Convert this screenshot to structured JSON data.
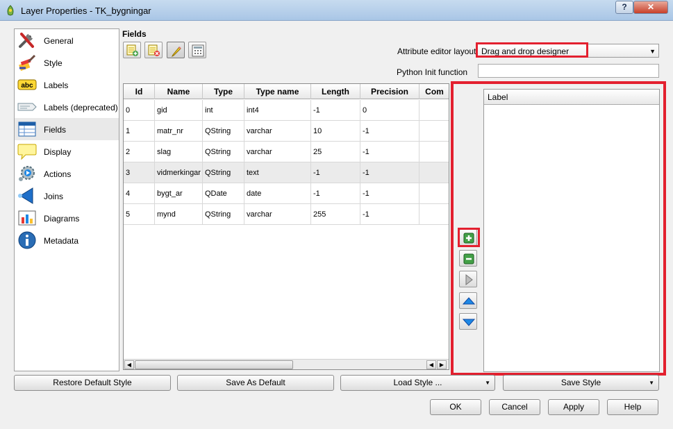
{
  "window": {
    "title": "Layer Properties - TK_bygningar",
    "help_label": "?",
    "close_label": "✕"
  },
  "sidebar": {
    "items": [
      {
        "label": "General",
        "icon": "tools-icon"
      },
      {
        "label": "Style",
        "icon": "brush-icon"
      },
      {
        "label": "Labels",
        "icon": "abc-label-icon"
      },
      {
        "label": "Labels (deprecated)",
        "icon": "label-tag-icon"
      },
      {
        "label": "Fields",
        "icon": "table-icon"
      },
      {
        "label": "Display",
        "icon": "speech-bubble-icon"
      },
      {
        "label": "Actions",
        "icon": "gear-play-icon"
      },
      {
        "label": "Joins",
        "icon": "join-arrow-icon"
      },
      {
        "label": "Diagrams",
        "icon": "chart-icon"
      },
      {
        "label": "Metadata",
        "icon": "info-icon"
      }
    ],
    "selected": "Fields"
  },
  "fields": {
    "title": "Fields",
    "columns": [
      "Id",
      "Name",
      "Type",
      "Type name",
      "Length",
      "Precision",
      "Com"
    ],
    "rows": [
      [
        "0",
        "gid",
        "int",
        "int4",
        "-1",
        "0",
        ""
      ],
      [
        "1",
        "matr_nr",
        "QString",
        "varchar",
        "10",
        "-1",
        ""
      ],
      [
        "2",
        "slag",
        "QString",
        "varchar",
        "25",
        "-1",
        ""
      ],
      [
        "3",
        "vidmerkingar",
        "QString",
        "text",
        "-1",
        "-1",
        ""
      ],
      [
        "4",
        "bygt_ar",
        "QDate",
        "date",
        "-1",
        "-1",
        ""
      ],
      [
        "5",
        "mynd",
        "QString",
        "varchar",
        "255",
        "-1",
        ""
      ]
    ],
    "highlighted_row": 3
  },
  "attribute_editor": {
    "layout_label": "Attribute editor layout:",
    "layout_value": "Drag and drop designer",
    "python_label": "Python Init function",
    "python_value": "",
    "tree_header": "Label"
  },
  "buttons": {
    "restore_default_style": "Restore Default Style",
    "save_as_default": "Save As Default",
    "load_style": "Load Style ...",
    "save_style": "Save Style",
    "ok": "OK",
    "cancel": "Cancel",
    "apply": "Apply",
    "help": "Help"
  },
  "colors": {
    "highlight_red": "#e3202f",
    "title_bar": "#b8d1ea"
  }
}
